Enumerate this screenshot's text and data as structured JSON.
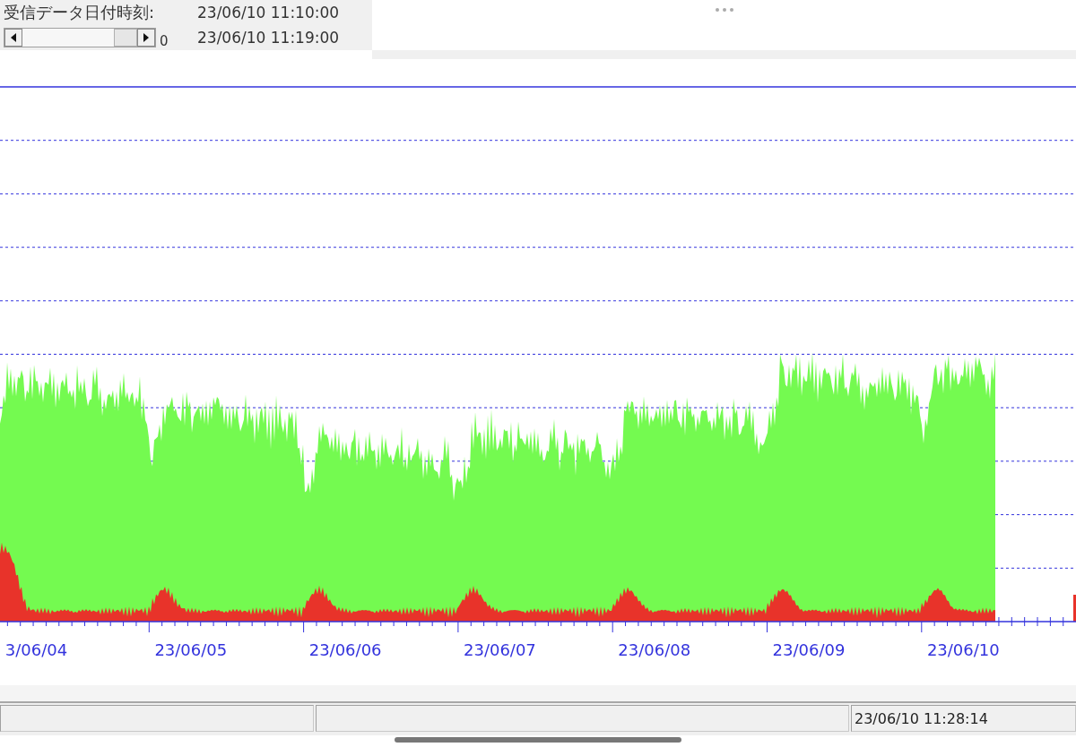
{
  "header": {
    "label": "受信データ日付時刻:",
    "start_time": "23/06/10 11:10:00",
    "end_time": "23/06/10 11:19:00",
    "scroll_value": "0"
  },
  "chart": {
    "x_axis_labels": [
      "3/06/04",
      "23/06/05",
      "23/06/06",
      "23/06/07",
      "23/06/08",
      "23/06/09",
      "23/06/10"
    ]
  },
  "status_bar": {
    "time": "23/06/10 11:28:14"
  }
}
